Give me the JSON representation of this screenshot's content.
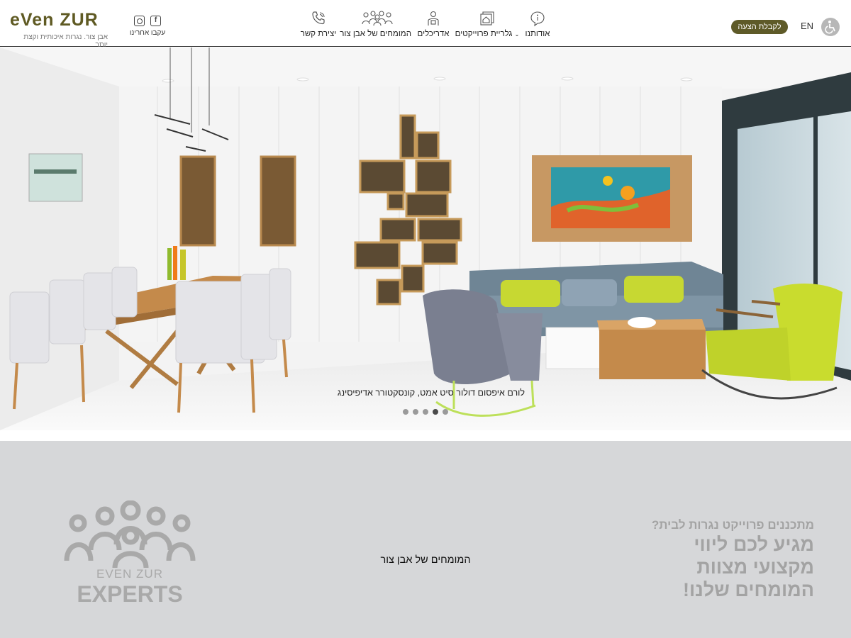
{
  "header": {
    "logo_text": "even zur",
    "logo_tagline": "אבן צור. נגרות איכותית וקצת יותר",
    "follow_label": "עקבו אחרינו",
    "nav": [
      {
        "label": "יצירת קשר",
        "icon": "phone-icon"
      },
      {
        "label": "המומחים של אבן צור",
        "icon": "people-icon"
      },
      {
        "label": "אדריכלים",
        "icon": "architect-icon"
      },
      {
        "label": "גלריית פרוייקטים",
        "icon": "gallery-icon"
      },
      {
        "label": "אודותנו",
        "icon": "info-icon"
      }
    ],
    "cta_label": "לקבלת הצעה",
    "lang_label": "EN",
    "accessibility_icon": "wheelchair-icon"
  },
  "hero": {
    "caption": "לורם איפסום דולור סיט אמט, קונסקטורר אדיפיסינג",
    "slide_count": 5,
    "active_slide": 2
  },
  "experts": {
    "center_text": "המומחים של אבן צור",
    "logo_line1": "EVEN ZUR",
    "logo_line2": "EXPERTS",
    "slogan_top": "מתכננים פרוייקט נגרות לבית?",
    "slogan_lines": [
      "מגיע לכם ליווי",
      "מקצועי מצוות",
      "המומחים שלנו!"
    ]
  },
  "colors": {
    "brand_olive": "#5e5a28",
    "band_gray": "#d6d7d9",
    "slogan_gray": "#a3a3a3"
  }
}
